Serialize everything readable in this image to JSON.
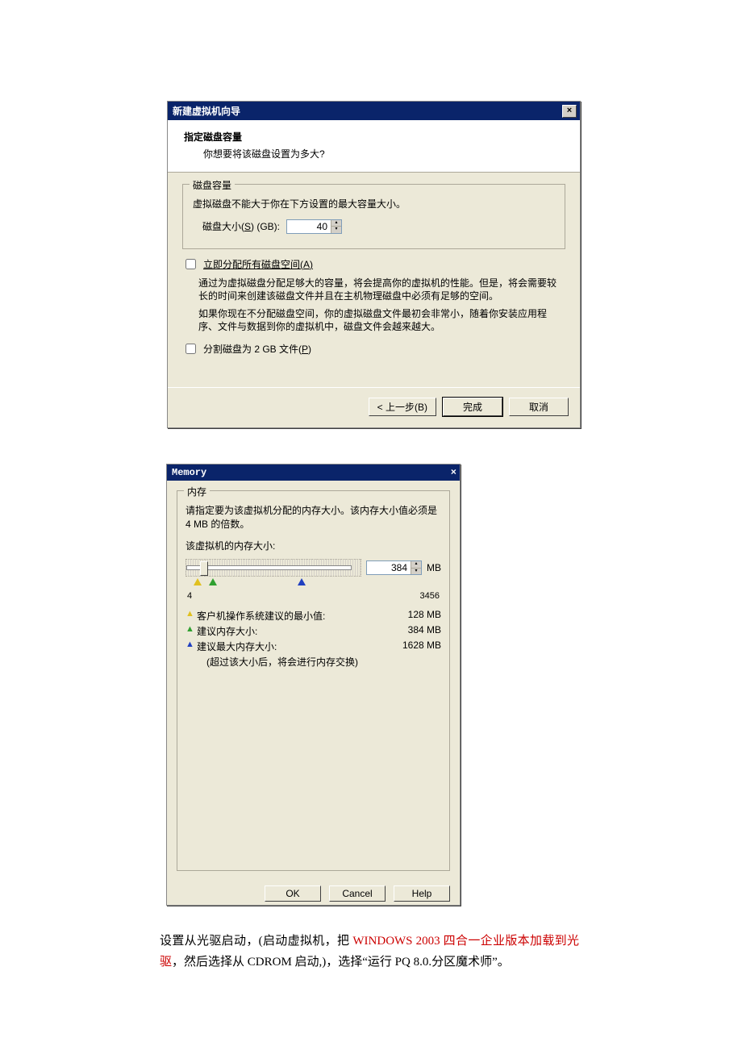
{
  "dialog1": {
    "title": "新建虚拟机向导",
    "header_title": "指定磁盘容量",
    "header_sub": "你想要将该磁盘设置为多大?",
    "group_legend": "磁盘容量",
    "line_limit": "虚拟磁盘不能大于你在下方设置的最大容量大小。",
    "size_label_pre": "磁盘大小(",
    "size_label_key": "S",
    "size_label_post": ") (GB):",
    "size_value": "40",
    "chk_allocate_label": "立即分配所有磁盘空间(",
    "chk_allocate_key": "A",
    "chk_allocate_post": ")",
    "allocate_note": "通过为虚拟磁盘分配足够大的容量，将会提高你的虚拟机的性能。但是，将会需要较长的时间来创建该磁盘文件并且在主机物理磁盘中必须有足够的空间。",
    "grow_note": "如果你现在不分配磁盘空间，你的虚拟磁盘文件最初会非常小，随着你安装应用程序、文件与数据到你的虚拟机中，磁盘文件会越来越大。",
    "chk_split_label": "分割磁盘为 2 GB 文件(",
    "chk_split_key": "P",
    "chk_split_post": ")",
    "btn_back": "< 上一步(B)",
    "btn_finish": "完成",
    "btn_cancel": "取消"
  },
  "dialog2": {
    "title": "Memory",
    "group_legend": "内存",
    "desc": "请指定要为该虚拟机分配的内存大小。该内存大小值必须是 4 MB 的倍数。",
    "size_label": "该虚拟机的内存大小:",
    "value": "384",
    "unit": "MB",
    "range_min": "4",
    "range_max": "3456",
    "rec_min_label": "客户机操作系统建议的最小值:",
    "rec_min_val": "128 MB",
    "rec_sug_label": "建议内存大小:",
    "rec_sug_val": "384 MB",
    "rec_max_label": "建议最大内存大小:",
    "rec_max_val": "1628 MB",
    "swap_note": "(超过该大小后，将会进行内存交换)",
    "btn_ok": "OK",
    "btn_cancel": "Cancel",
    "btn_help": "Help"
  },
  "bodytext": {
    "pre": "设置从光驱启动，(启动虚拟机，把 ",
    "red": "WINDOWS 2003 四合一企业版本加载到光驱",
    "post": "，然后选择从 CDROM 启动,)，选择“运行 PQ 8.0.分区魔术师”。"
  }
}
